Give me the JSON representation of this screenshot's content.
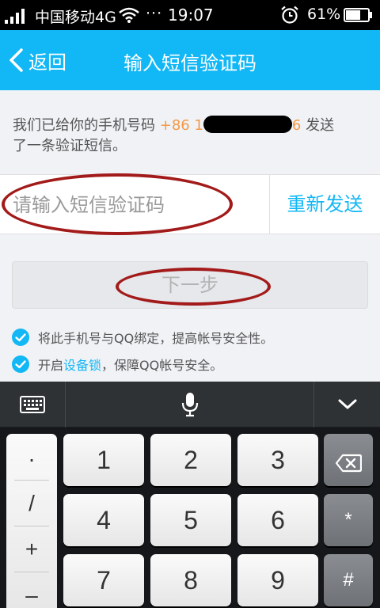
{
  "status_bar": {
    "carrier": "中国移动4G",
    "dots": "···",
    "time": "19:07",
    "battery": "61%"
  },
  "header": {
    "back_label": "返回",
    "title": "输入短信验证码"
  },
  "notice": {
    "prefix": "我们已给你的手机号码",
    "country_code": "+86",
    "phone_start": "1",
    "phone_end": "6",
    "suffix_1": "发送",
    "suffix_2": "了一条验证短信。"
  },
  "code_input": {
    "placeholder": "请输入短信验证码",
    "value": ""
  },
  "resend_label": "重新发送",
  "next_label": "下一步",
  "options": {
    "bind_text": "将此手机号与QQ绑定，提高帐号安全性。",
    "lock_prefix": "开启",
    "lock_link": "设备锁",
    "lock_suffix": "，保障QQ帐号安全。"
  },
  "keyboard": {
    "symbols": [
      "·",
      "/",
      "+",
      "–"
    ],
    "digits": [
      "1",
      "2",
      "3",
      "4",
      "5",
      "6",
      "7",
      "8",
      "9"
    ],
    "side_keys": [
      "*",
      "#"
    ]
  },
  "colors": {
    "accent": "#12b7f5",
    "highlight_orange": "#f39a48",
    "annotation_red": "#a31a1a"
  },
  "icons": [
    "signal-icon",
    "wifi-icon",
    "alarm-icon",
    "battery-icon",
    "back-chevron-icon",
    "check-icon",
    "keyboard-icon",
    "microphone-icon",
    "chevron-down-icon",
    "backspace-icon"
  ]
}
